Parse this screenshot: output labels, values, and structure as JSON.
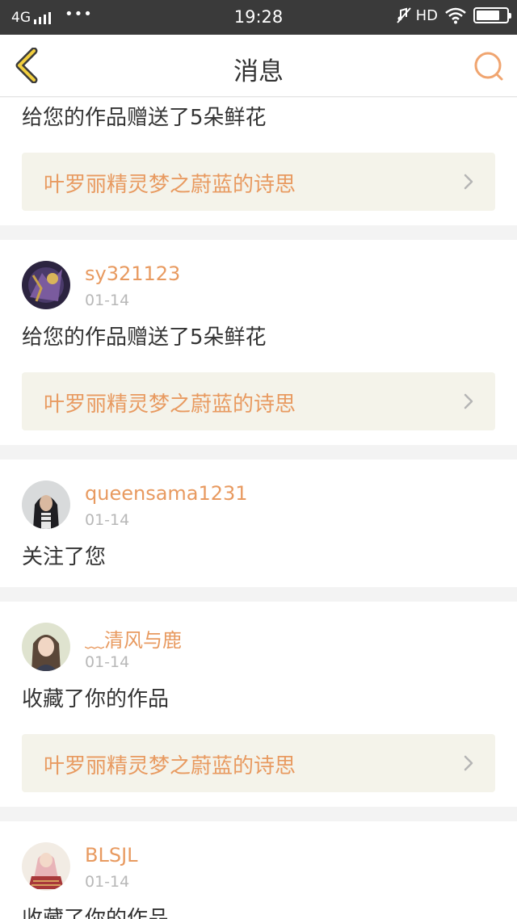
{
  "status_bar": {
    "network": "4G",
    "dots": "•••",
    "time": "19:28",
    "hd": "HD"
  },
  "nav": {
    "title": "消息"
  },
  "colors": {
    "accent": "#e89a60",
    "text": "#333333",
    "muted": "#b8b8b8",
    "link_bg": "#f4f3ea"
  },
  "notifications": [
    {
      "message": "给您的作品赠送了5朵鲜花",
      "work": "叶罗丽精灵梦之蔚蓝的诗思"
    },
    {
      "username": "sy321123",
      "time": "01-14",
      "message": "给您的作品赠送了5朵鲜花",
      "work": "叶罗丽精灵梦之蔚蓝的诗思"
    },
    {
      "username": "queensama1231",
      "time": "01-14",
      "message": "关注了您"
    },
    {
      "username": "﹏清风与鹿",
      "time": "01-14",
      "message": "收藏了你的作品",
      "work": "叶罗丽精灵梦之蔚蓝的诗思"
    },
    {
      "username": "BLSJL",
      "time": "01-14",
      "message": "收藏了你的作品"
    }
  ]
}
